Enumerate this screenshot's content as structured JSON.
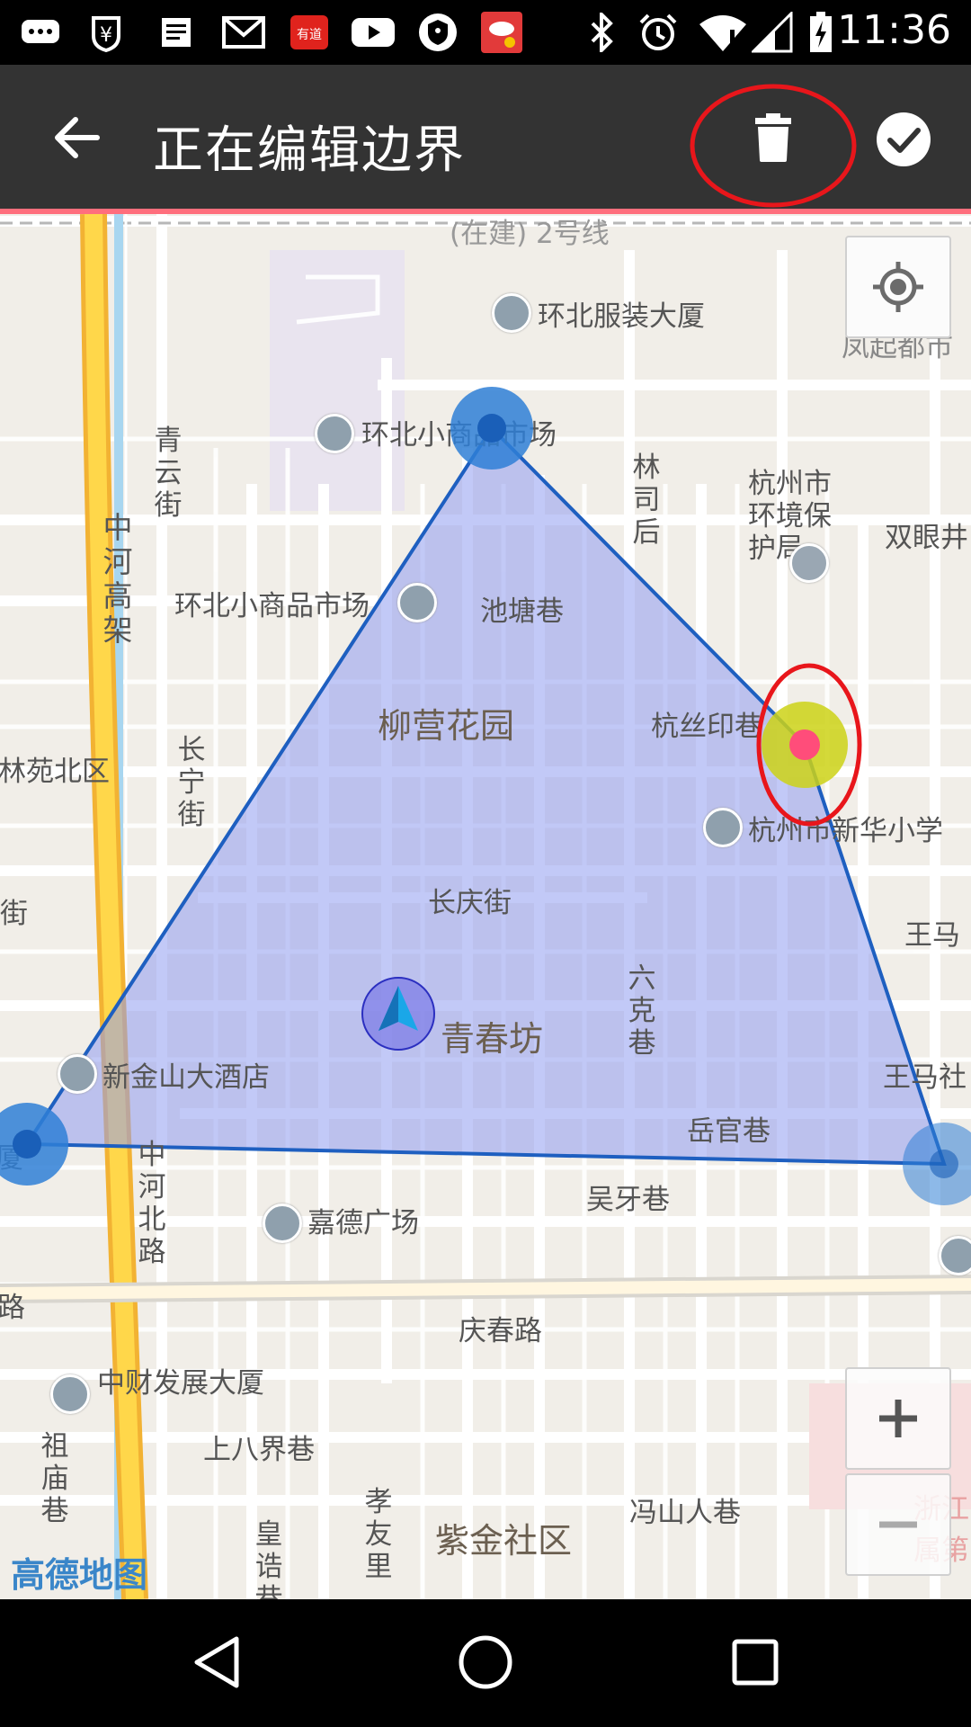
{
  "status_bar": {
    "time": "11:36",
    "left_icons": [
      "messaging-icon",
      "payment-icon",
      "notes-icon",
      "gmail-icon",
      "youdao-icon",
      "youtube-icon",
      "vpn-shield-icon",
      "alert-camera-icon"
    ],
    "right_icons": [
      "bluetooth-icon",
      "alarm-icon",
      "wifi-icon",
      "signal-icon",
      "battery-charging-icon"
    ]
  },
  "app_bar": {
    "title": "正在编辑边界",
    "back_icon": "arrow-back-icon",
    "delete_icon": "trash-icon",
    "confirm_icon": "check-circle-icon",
    "accent_line_color": "#ff6f7d",
    "background_color": "#333333"
  },
  "map": {
    "labels": {
      "metro_line": "(在建) 2号线",
      "huanbei_fashion": "环北服装大厦",
      "fengqi_city": "凤起都市",
      "huanbei_market_top": "环北小商品市场",
      "qingyun_st": "青云街",
      "zhonghe_elevated": "中河高架",
      "linsi_hou": "林司后",
      "env_bureau": "杭州市环境保护局",
      "shuangyanjing": "双眼井",
      "huanbei_market_mid": "环北小商品市场",
      "chitang_lane": "池塘巷",
      "liuying_garden": "柳营花园",
      "hangsi_lane": "杭丝印巷",
      "linyuan_north": "林苑北区",
      "changning_st": "长宁街",
      "xinhua_school": "杭州市新华小学",
      "changqing_st": "长庆街",
      "jie_left": "街",
      "wangma_1": "王马",
      "liuke_lane": "六克巷",
      "qingchunfang": "青春坊",
      "xinjinshan_hotel": "新金山大酒店",
      "wangma_2": "王马社",
      "yueguan_lane": "岳官巷",
      "xia_left": "大厦",
      "zhonghe_north_rd": "中河北路",
      "wuya_lane": "吴牙巷",
      "jiade_plaza": "嘉德广场",
      "lu_left": "春路",
      "qingchun_rd": "庆春路",
      "zhongcai_building": "中财发展大厦",
      "zumiao_lane": "祖庙巷",
      "shangbajie_lane": "上八界巷",
      "xiaoyou_li": "孝友里",
      "huangzao_lane": "皇诰巷",
      "zijin_community": "紫金社区",
      "fengshanren_lane": "冯山人巷",
      "zhe_right": "浙江",
      "shu_right": "属第"
    },
    "logo": "高德地图",
    "locate_icon": "crosshair-locate-icon",
    "zoom_in_icon": "plus-icon",
    "zoom_out_icon": "minus-icon",
    "polygon_fill": "#8f9cf0",
    "polygon_stroke": "#1e5fc0",
    "vertex_color": "#2f7fd6",
    "selected_vertex_color": "#ff4d7a"
  },
  "nav_bar": {
    "back_icon": "nav-back-triangle-icon",
    "home_icon": "nav-home-circle-icon",
    "recents_icon": "nav-recents-square-icon"
  }
}
